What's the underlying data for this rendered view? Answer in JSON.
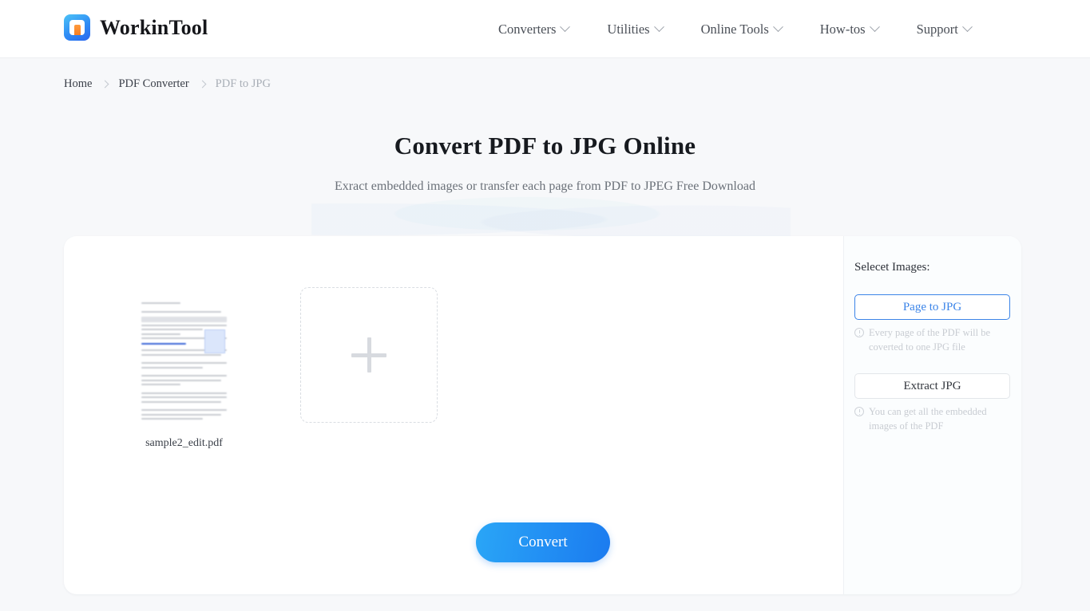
{
  "header": {
    "brand": "WorkinTool",
    "logo_icon": "workintool-logo-icon",
    "nav": [
      {
        "label": "Converters",
        "icon": "chevron-down-icon"
      },
      {
        "label": "Utilities",
        "icon": "chevron-down-icon"
      },
      {
        "label": "Online Tools",
        "icon": "chevron-down-icon"
      },
      {
        "label": "How-tos",
        "icon": "chevron-down-icon"
      },
      {
        "label": "Support",
        "icon": "chevron-down-icon"
      }
    ]
  },
  "breadcrumb": {
    "items": [
      "Home",
      "PDF Converter",
      "PDF to JPG"
    ],
    "separator_icon": "chevron-right-icon"
  },
  "hero": {
    "title": "Convert PDF to JPG Online",
    "subtitle": "Exract embedded images or transfer each page from PDF to JPEG Free Download"
  },
  "workspace": {
    "file": {
      "name": "sample2_edit.pdf",
      "thumbnail_icon": "pdf-page-thumbnail"
    },
    "add_file": {
      "icon": "plus-icon"
    },
    "convert_button": "Convert"
  },
  "options_panel": {
    "title": "Selecet Images:",
    "options": [
      {
        "label": "Page to JPG",
        "selected": true,
        "hint": "Every page of the PDF will be coverted to one JPG file",
        "hint_icon": "exclamation-circle-icon"
      },
      {
        "label": "Extract JPG",
        "selected": false,
        "hint": "You can get all the embedded images of the PDF",
        "hint_icon": "exclamation-circle-icon"
      }
    ]
  },
  "colors": {
    "page_background": "#f7f8fa",
    "card_background": "#ffffff",
    "accent_blue": "#2392f4",
    "selected_border": "#3b84e8",
    "text_primary": "#171a1f",
    "text_muted": "#6b7179",
    "hint_text": "#c8ccd2",
    "logo_blue": "#2f8cf5",
    "logo_orange": "#f77f24"
  }
}
